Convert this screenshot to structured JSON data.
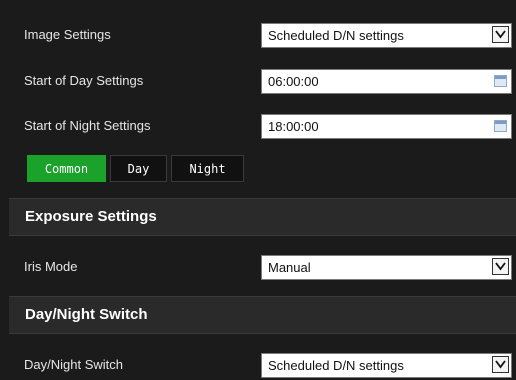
{
  "image_settings": {
    "label": "Image Settings",
    "value": "Scheduled D/N settings"
  },
  "start_of_day": {
    "label": "Start of Day Settings",
    "value": "06:00:00"
  },
  "start_of_night": {
    "label": "Start of Night Settings",
    "value": "18:00:00"
  },
  "tabs": [
    {
      "label": "Common",
      "active": true
    },
    {
      "label": "Day",
      "active": false
    },
    {
      "label": "Night",
      "active": false
    }
  ],
  "exposure": {
    "title": "Exposure Settings",
    "iris_mode_label": "Iris Mode",
    "iris_mode_value": "Manual"
  },
  "day_night": {
    "title": "Day/Night Switch",
    "label": "Day/Night Switch",
    "value": "Scheduled D/N settings"
  },
  "colors": {
    "background": "#1b1b1b",
    "section_bg": "#2a2a2a",
    "active_tab": "#1aa22a"
  },
  "icons": {
    "dropdown": "chevron-down-icon",
    "date": "calendar-icon"
  }
}
